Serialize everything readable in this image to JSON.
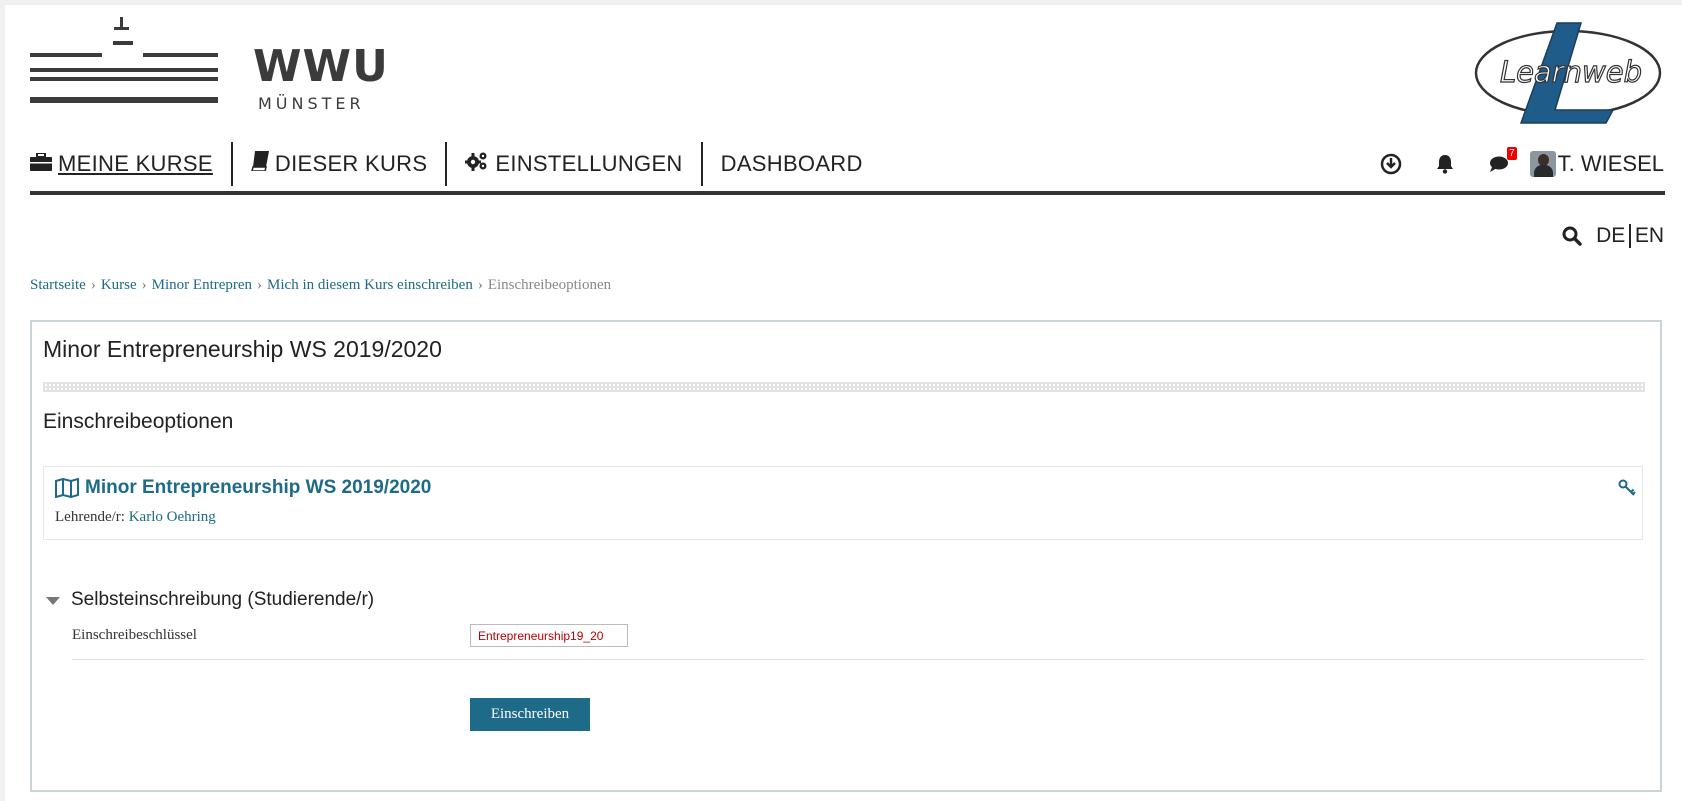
{
  "header": {
    "brand_name": "WWU",
    "brand_sub": "MÜNSTER",
    "platform_logo_text": "Learnweb"
  },
  "nav": {
    "items": [
      {
        "label": "MEINE KURSE",
        "icon": "briefcase-icon"
      },
      {
        "label": "DIESER KURS",
        "icon": "book-icon"
      },
      {
        "label": "EINSTELLUNGEN",
        "icon": "gears-icon"
      },
      {
        "label": "DASHBOARD",
        "icon": ""
      }
    ],
    "messages_badge": "7",
    "user_name": "T. WIESEL"
  },
  "lang": {
    "de": "DE",
    "en": "EN"
  },
  "breadcrumb": [
    "Startseite",
    "Kurse",
    "Minor Entrepren",
    "Mich in diesem Kurs einschreiben",
    "Einschreibeoptionen"
  ],
  "main": {
    "course_title": "Minor Entrepreneurship WS 2019/2020",
    "section_heading": "Einschreibeoptionen",
    "coursebox": {
      "title": "Minor Entrepreneurship WS 2019/2020",
      "teacher_label": "Lehrende/r:",
      "teacher_name": "Karlo Oehring"
    },
    "enrolment": {
      "heading": "Selbsteinschreibung (Studierende/r)",
      "key_label": "Einschreibeschlüssel",
      "key_value": "Entrepreneurship19_20",
      "submit_label": "Einschreiben"
    }
  },
  "colors": {
    "link": "#1d6a89",
    "button_bg": "#1d6a89",
    "badge": "#e00000",
    "logo_blue": "#1f5c8a"
  }
}
